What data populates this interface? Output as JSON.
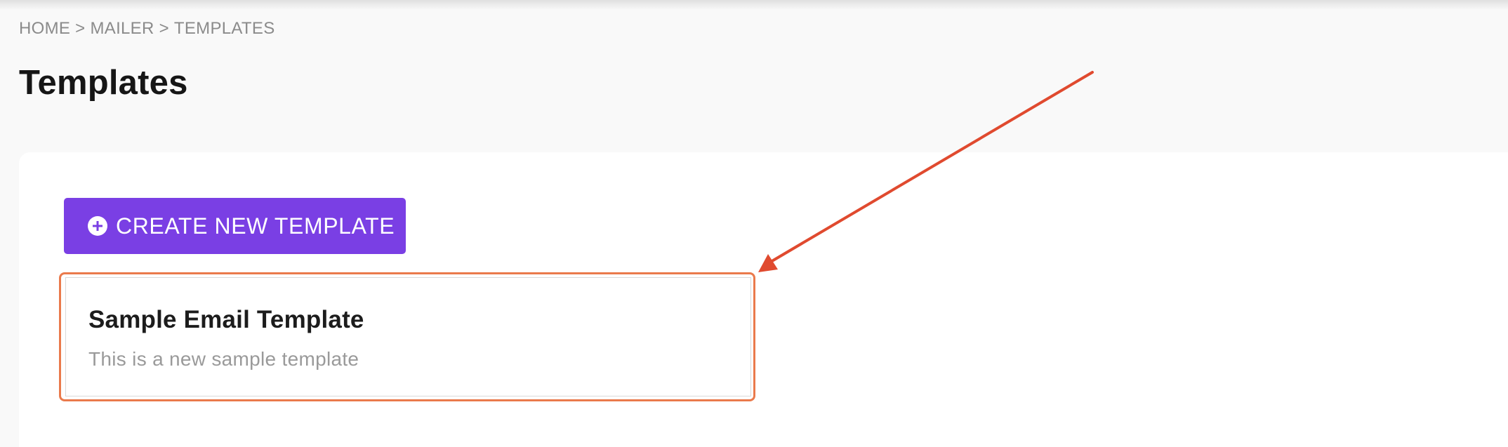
{
  "breadcrumb": {
    "items": [
      "HOME",
      "MAILER",
      "TEMPLATES"
    ],
    "separator": ">"
  },
  "page": {
    "title": "Templates"
  },
  "toolbar": {
    "create_label": "CREATE NEW TEMPLATE",
    "create_icon": "plus-circle-icon"
  },
  "templates": [
    {
      "title": "Sample Email Template",
      "description": "This is a new sample template"
    }
  ],
  "annotation": {
    "arrow_color": "#e04a2f",
    "highlight_color": "#ea7a4c"
  },
  "colors": {
    "accent": "#7a3fe4",
    "background": "#f9f9f9",
    "card": "#ffffff"
  }
}
